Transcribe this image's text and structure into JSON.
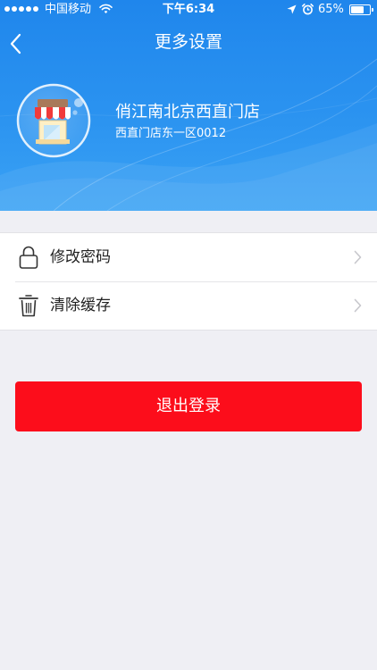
{
  "status_bar": {
    "carrier": "中国移动",
    "time": "下午6:34",
    "battery_text": "65%",
    "battery_level": 0.65,
    "signal_dots": 5,
    "icons": [
      "wifi-icon",
      "location-arrow-icon",
      "alarm-clock-icon",
      "battery-icon"
    ]
  },
  "nav": {
    "title": "更多设置",
    "back_icon": "chevron-left-icon"
  },
  "profile": {
    "store_name": "俏江南北京西直门店",
    "store_address": "西直门店东一区0012",
    "avatar_icon": "storefront-icon"
  },
  "settings": {
    "items": [
      {
        "label": "修改密码",
        "icon": "lock-icon"
      },
      {
        "label": "清除缓存",
        "icon": "trash-icon"
      }
    ],
    "chevron_icon": "chevron-right-icon"
  },
  "logout": {
    "label": "退出登录"
  },
  "colors": {
    "header_blue": "#1f86ec",
    "logout_red": "#fc0d1b",
    "page_background": "#efeff4"
  }
}
